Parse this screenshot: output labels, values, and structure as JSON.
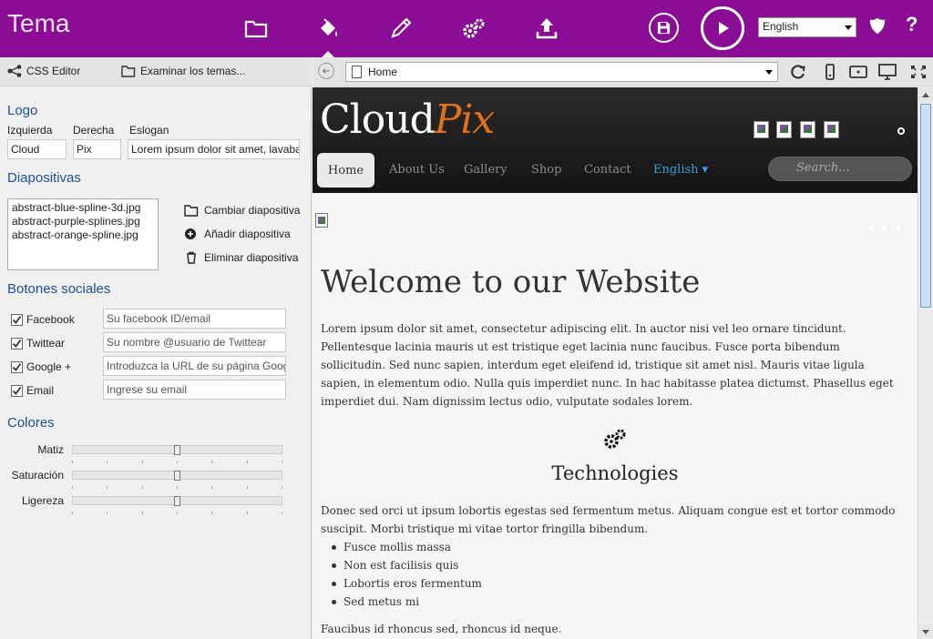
{
  "app": {
    "title": "Tema"
  },
  "topbar": {
    "language": "English",
    "help": "?",
    "colors": {
      "bar": "#8b0d96",
      "icon": "#ffffff"
    }
  },
  "left_toolbar": {
    "css_editor": "CSS Editor",
    "browse_themes": "Examinar los temas..."
  },
  "logo": {
    "title": "Logo",
    "left_label": "Izquierda",
    "right_label": "Derecha",
    "slogan_label": "Eslogan",
    "left_value": "Cloud",
    "right_value": "Pix",
    "slogan_value": "Lorem ipsum dolor sit amet, lavaba"
  },
  "slides": {
    "title": "Diapositivas",
    "items": [
      "abstract-blue-spline-3d.jpg",
      "abstract-purple-splines.jpg",
      "abstract-orange-spline.jpg"
    ],
    "change": "Cambiar diapositiva",
    "add": "Añadir diapositiva",
    "remove": "Eliminar diapositiva"
  },
  "social": {
    "title": "Botones sociales",
    "items": [
      {
        "label": "Facebook",
        "placeholder": "Su facebook ID/email"
      },
      {
        "label": "Twittear",
        "placeholder": "Su nombre @usuario de Twittear"
      },
      {
        "label": "Google +",
        "placeholder": "Introduzca la URL de su página Goog"
      },
      {
        "label": "Email",
        "placeholder": "Ingrese su email"
      }
    ]
  },
  "colors": {
    "title": "Colores",
    "sliders": [
      {
        "label": "Matiz",
        "value": 0.5
      },
      {
        "label": "Saturación",
        "value": 0.5
      },
      {
        "label": "Ligereza",
        "value": 0.5
      }
    ]
  },
  "browser": {
    "url": "Home"
  },
  "site": {
    "logo_left": "Cloud",
    "logo_right": "Pix",
    "nav": [
      "Home",
      "About Us",
      "Gallery",
      "Shop",
      "Contact",
      "English ▾"
    ],
    "search_placeholder": "Search...",
    "welcome": "Welcome to our Website",
    "intro": "Lorem ipsum dolor sit amet, consectetur adipiscing elit. In auctor nisi vel leo ornare tincidunt. Pellentesque lacinia mauris ut est tristique eget lacinia nunc faucibus. Fusce porta bibendum sollicitudin. Sed nunc sapien, interdum eget eleifend id, tristique sit amet nisl. Mauris vitae ligula sapien, in elementum odio. Nulla quis imperdiet nunc. In hac habitasse platea dictumst. Phasellus eget imperdiet dui. Nam dignissim lectus odio, vulputate sodales lorem.",
    "tech_title": "Technologies",
    "tech_para": "Donec sed orci ut ipsum lobortis egestas sed fermentum metus. Aliquam congue est et tortor commodo suscipit. Morbi tristique mi vitae tortor fringilla bibendum.",
    "bullets": [
      "Fusce mollis massa",
      "Non est facilisis quis",
      "Lobortis eros fermentum",
      "Sed metus mi"
    ],
    "footer_para": "Faucibus id rhoncus sed, rhoncus id neque.",
    "accent": "#e0701a",
    "link_color": "#3aa0e0"
  }
}
